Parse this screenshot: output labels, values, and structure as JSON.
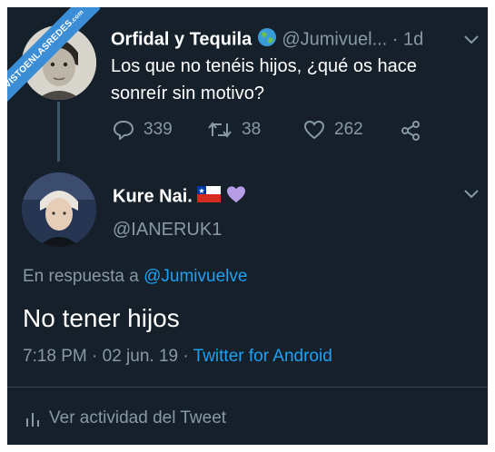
{
  "watermark": {
    "main": "VISTOENLASREDES",
    "sub": ".com"
  },
  "tweet1": {
    "display_name": "Orfidal y Tequila",
    "handle_time": "@Jumivuel... · 1d",
    "text_line1": "Los que no tenéis hijos, ¿qué os hace",
    "text_line2": "sonreír sin motivo?",
    "replies": "339",
    "retweets": "38",
    "likes": "262"
  },
  "tweet2": {
    "display_name": "Kure Nai.",
    "handle": "@IANERUK1",
    "reply_prefix": "En respuesta a",
    "reply_to": "@Jumivuelve",
    "text": "No tener hijos",
    "time_date": "7:18 PM · 02 jun. 19 · ",
    "source": "Twitter for Android",
    "activity": "Ver actividad del Tweet"
  },
  "colors": {
    "background": "#15202b",
    "text": "#ffffff",
    "muted": "#8899a6",
    "link": "#1da1f2",
    "divider": "#38444d",
    "heart_emoji": "#b79ce6"
  },
  "icons": [
    "globe-icon",
    "chevron-down-icon",
    "reply-icon",
    "retweet-icon",
    "like-icon",
    "share-icon",
    "chile-flag-icon",
    "purple-heart-icon",
    "analytics-icon"
  ]
}
